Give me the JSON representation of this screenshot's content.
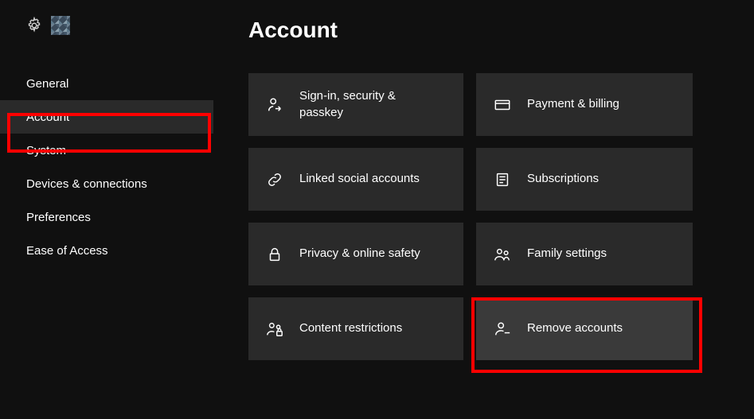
{
  "page_title": "Account",
  "sidebar": {
    "items": [
      {
        "label": "General"
      },
      {
        "label": "Account"
      },
      {
        "label": "System"
      },
      {
        "label": "Devices & connections"
      },
      {
        "label": "Preferences"
      },
      {
        "label": "Ease of Access"
      }
    ],
    "selected_index": 1
  },
  "tiles": [
    {
      "icon": "person-arrow-icon",
      "label": "Sign-in, security & passkey"
    },
    {
      "icon": "credit-card-icon",
      "label": "Payment & billing"
    },
    {
      "icon": "link-icon",
      "label": "Linked social accounts"
    },
    {
      "icon": "receipt-icon",
      "label": "Subscriptions"
    },
    {
      "icon": "lock-icon",
      "label": "Privacy & online safety"
    },
    {
      "icon": "family-icon",
      "label": "Family settings"
    },
    {
      "icon": "person-lock-icon",
      "label": "Content restrictions"
    },
    {
      "icon": "person-minus-icon",
      "label": "Remove accounts"
    }
  ],
  "highlights": {
    "sidebar_index": 1,
    "tile_index": 7,
    "color": "#ff0000"
  }
}
